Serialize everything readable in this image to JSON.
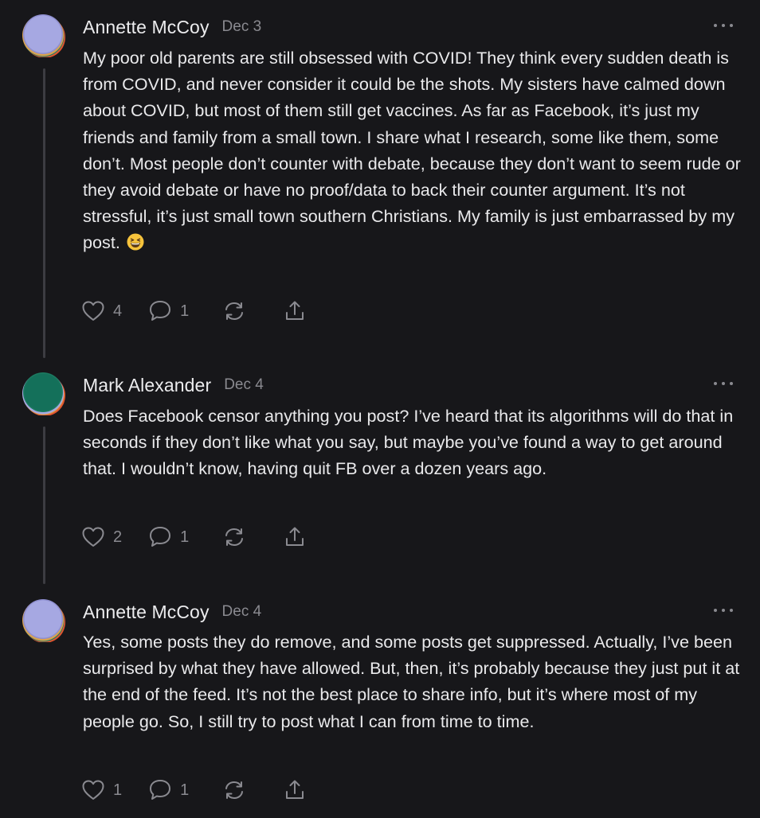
{
  "comments": [
    {
      "author": "Annette McCoy",
      "date": "Dec 3",
      "avatar_icon": "annette-avatar",
      "body": "My poor old parents are still obsessed with COVID! They think every sudden death is from COVID, and never consider it could be the shots. My sisters have calmed down about COVID, but most of them still get vaccines. As far as Facebook, it’s just my friends and family from a small town. I share what I research, some like them, some don’t. Most people don’t counter with debate, because they don’t want to seem rude or they avoid debate or have no proof/data to back their counter argument. It’s not stressful, it’s just small town southern Christians. My family is just embarrassed by my post.",
      "emoji_icon": "grinning-squinting-face-emoji",
      "likes": "4",
      "replies": "1"
    },
    {
      "author": "Mark Alexander",
      "date": "Dec 4",
      "avatar_icon": "mark-avatar",
      "body": "Does Facebook censor anything you post? I’ve heard that its algorithms will do that in seconds if they don’t like what you say, but maybe you’ve found a way to get around that. I wouldn’t know, having quit FB over a dozen years ago.",
      "likes": "2",
      "replies": "1"
    },
    {
      "author": "Annette McCoy",
      "date": "Dec 4",
      "avatar_icon": "annette-avatar",
      "body": "Yes, some posts they do remove, and some posts get suppressed. Actually, I’ve been surprised by what they have allowed. But, then, it’s probably because they just put it at the end of the feed. It’s not the best place to share info, but it’s where most of my people go. So, I still try to post what I can from time to time.",
      "likes": "1",
      "replies": "1"
    }
  ],
  "icons": {
    "like": "heart-icon",
    "reply": "speech-bubble-icon",
    "restack": "restack-icon",
    "share": "share-icon",
    "more": "more-options-icon"
  },
  "colors": {
    "background": "#17171a",
    "text": "#e9e9eb",
    "muted": "#8a8a90",
    "thread_line": "#3d3d42"
  }
}
